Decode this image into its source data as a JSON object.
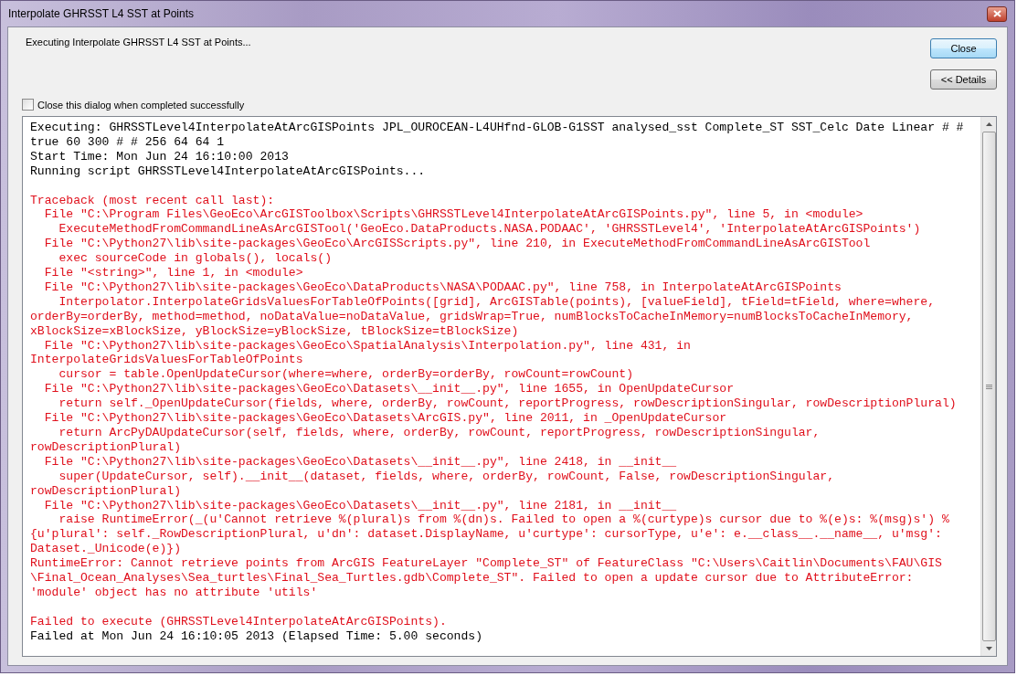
{
  "window": {
    "title": "Interpolate GHRSST L4 SST at Points"
  },
  "status_text": "Executing Interpolate GHRSST L4 SST at Points...",
  "buttons": [
    {
      "label": "Close",
      "kind": "default"
    },
    {
      "label": "<< Details",
      "kind": "normal"
    }
  ],
  "close_when_done": {
    "label": "Close this dialog when completed successfully",
    "checked": false
  },
  "log": [
    [
      {
        "kind": "info",
        "text": "Executing: GHRSSTLevel4InterpolateAtArcGISPoints JPL_OUROCEAN-L4UHfnd-GLOB-G1SST analysed_sst Complete_ST SST_Celc Date Linear # #"
      },
      {
        "kind": "info",
        "text": "true 60 300 # # 256 64 64 1"
      },
      {
        "kind": "info",
        "text": "Start Time: Mon Jun 24 16:10:00 2013"
      },
      {
        "kind": "info",
        "text": "Running script GHRSSTLevel4InterpolateAtArcGISPoints..."
      }
    ],
    [
      {
        "kind": "error",
        "text": "Traceback (most recent call last):"
      },
      {
        "kind": "error",
        "text": "  File \"C:\\Program Files\\GeoEco\\ArcGISToolbox\\Scripts\\GHRSSTLevel4InterpolateAtArcGISPoints.py\", line 5, in <module>"
      },
      {
        "kind": "error",
        "text": "    ExecuteMethodFromCommandLineAsArcGISTool('GeoEco.DataProducts.NASA.PODAAC', 'GHRSSTLevel4', 'InterpolateAtArcGISPoints')"
      },
      {
        "kind": "error",
        "text": "  File \"C:\\Python27\\lib\\site-packages\\GeoEco\\ArcGISScripts.py\", line 210, in ExecuteMethodFromCommandLineAsArcGISTool"
      },
      {
        "kind": "error",
        "text": "    exec sourceCode in globals(), locals()"
      },
      {
        "kind": "error",
        "text": "  File \"<string>\", line 1, in <module>"
      },
      {
        "kind": "error",
        "text": "  File \"C:\\Python27\\lib\\site-packages\\GeoEco\\DataProducts\\NASA\\PODAAC.py\", line 758, in InterpolateAtArcGISPoints"
      },
      {
        "kind": "error",
        "text": "    Interpolator.InterpolateGridsValuesForTableOfPoints([grid], ArcGISTable(points), [valueField], tField=tField, where=where,"
      },
      {
        "kind": "error",
        "text": "orderBy=orderBy, method=method, noDataValue=noDataValue, gridsWrap=True, numBlocksToCacheInMemory=numBlocksToCacheInMemory,"
      },
      {
        "kind": "error",
        "text": "xBlockSize=xBlockSize, yBlockSize=yBlockSize, tBlockSize=tBlockSize)"
      },
      {
        "kind": "error",
        "text": "  File \"C:\\Python27\\lib\\site-packages\\GeoEco\\SpatialAnalysis\\Interpolation.py\", line 431, in"
      },
      {
        "kind": "error",
        "text": "InterpolateGridsValuesForTableOfPoints"
      },
      {
        "kind": "error",
        "text": "    cursor = table.OpenUpdateCursor(where=where, orderBy=orderBy, rowCount=rowCount)"
      },
      {
        "kind": "error",
        "text": "  File \"C:\\Python27\\lib\\site-packages\\GeoEco\\Datasets\\__init__.py\", line 1655, in OpenUpdateCursor"
      },
      {
        "kind": "error",
        "text": "    return self._OpenUpdateCursor(fields, where, orderBy, rowCount, reportProgress, rowDescriptionSingular, rowDescriptionPlural)"
      },
      {
        "kind": "error",
        "text": "  File \"C:\\Python27\\lib\\site-packages\\GeoEco\\Datasets\\ArcGIS.py\", line 2011, in _OpenUpdateCursor"
      },
      {
        "kind": "error",
        "text": "    return ArcPyDAUpdateCursor(self, fields, where, orderBy, rowCount, reportProgress, rowDescriptionSingular,"
      },
      {
        "kind": "error",
        "text": "rowDescriptionPlural)"
      },
      {
        "kind": "error",
        "text": "  File \"C:\\Python27\\lib\\site-packages\\GeoEco\\Datasets\\__init__.py\", line 2418, in __init__"
      },
      {
        "kind": "error",
        "text": "    super(UpdateCursor, self).__init__(dataset, fields, where, orderBy, rowCount, False, rowDescriptionSingular,"
      },
      {
        "kind": "error",
        "text": "rowDescriptionPlural)"
      },
      {
        "kind": "error",
        "text": "  File \"C:\\Python27\\lib\\site-packages\\GeoEco\\Datasets\\__init__.py\", line 2181, in __init__"
      },
      {
        "kind": "error",
        "text": "    raise RuntimeError(_(u'Cannot retrieve %(plural)s from %(dn)s. Failed to open a %(curtype)s cursor due to %(e)s: %(msg)s') %"
      },
      {
        "kind": "error",
        "text": "{u'plural': self._RowDescriptionPlural, u'dn': dataset.DisplayName, u'curtype': cursorType, u'e': e.__class__.__name__, u'msg':"
      },
      {
        "kind": "error",
        "text": "Dataset._Unicode(e)})"
      },
      {
        "kind": "error",
        "text": "RuntimeError: Cannot retrieve points from ArcGIS FeatureLayer \"Complete_ST\" of FeatureClass \"C:\\Users\\Caitlin\\Documents\\FAU\\GIS"
      },
      {
        "kind": "error",
        "text": "\\Final_Ocean_Analyses\\Sea_turtles\\Final_Sea_Turtles.gdb\\Complete_ST\". Failed to open a update cursor due to AttributeError:"
      },
      {
        "kind": "error",
        "text": "'module' object has no attribute 'utils'"
      }
    ],
    [
      {
        "kind": "error",
        "text": "Failed to execute (GHRSSTLevel4InterpolateAtArcGISPoints)."
      },
      {
        "kind": "info",
        "text": "Failed at Mon Jun 24 16:10:05 2013 (Elapsed Time: 5.00 seconds)"
      }
    ]
  ]
}
